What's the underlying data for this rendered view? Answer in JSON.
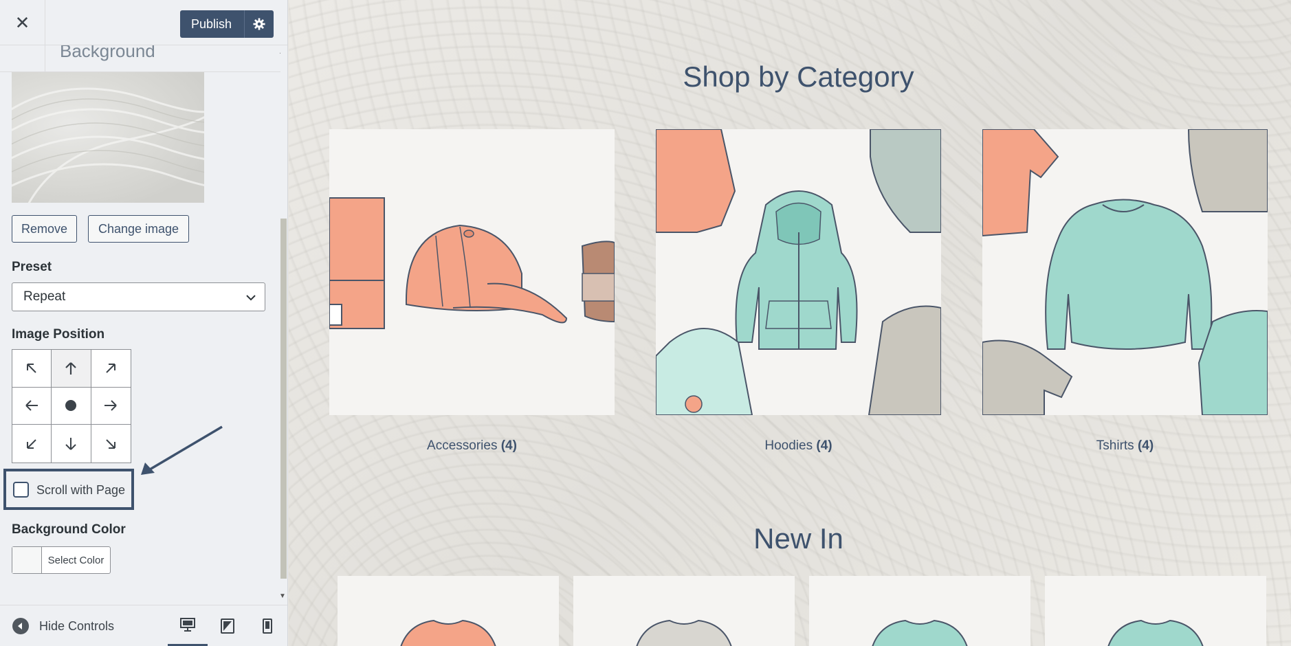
{
  "topbar": {
    "publish_label": "Publish"
  },
  "section": {
    "title": "Background"
  },
  "buttons": {
    "remove": "Remove",
    "change_image": "Change image"
  },
  "preset": {
    "label": "Preset",
    "value": "Repeat"
  },
  "image_position": {
    "label": "Image Position",
    "selected": "center"
  },
  "scroll_with_page": {
    "label": "Scroll with Page",
    "checked": false
  },
  "background_color": {
    "label": "Background Color",
    "button": "Select Color"
  },
  "footer": {
    "hide_controls": "Hide Controls"
  },
  "preview": {
    "shop_heading": "Shop by Category",
    "categories": [
      {
        "name": "Accessories",
        "count": "(4)"
      },
      {
        "name": "Hoodies",
        "count": "(4)"
      },
      {
        "name": "Tshirts",
        "count": "(4)"
      }
    ],
    "new_in_heading": "New In"
  },
  "colors": {
    "accent": "#3e526d",
    "coral": "#f4a488",
    "mint": "#9fd8cc",
    "grey": "#c9c6bd"
  }
}
